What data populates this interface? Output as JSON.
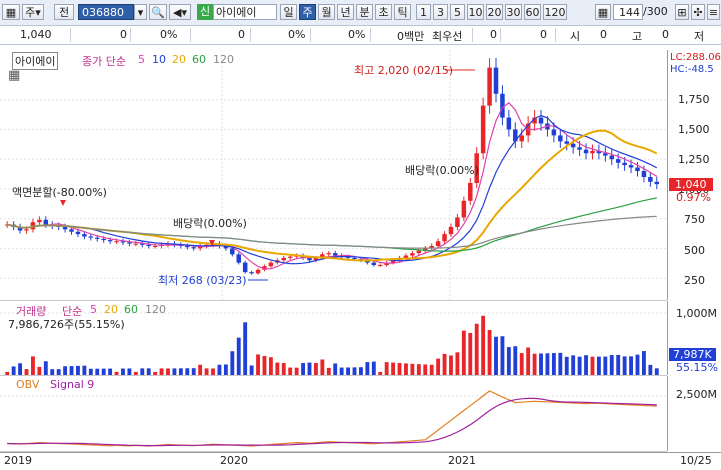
{
  "toolbar": {
    "market": "주",
    "prev": "전",
    "code": "036880",
    "mode": "신",
    "name": "아이에이",
    "periods": [
      "일",
      "주",
      "월",
      "년",
      "분",
      "초",
      "틱"
    ],
    "nums": [
      "1",
      "3",
      "5",
      "10",
      "20",
      "30",
      "60",
      "120"
    ],
    "count": "144",
    "total": "/300"
  },
  "info": {
    "price": "1,040",
    "v1": "0",
    "v2": "0%",
    "v3": "0",
    "v4": "0%",
    "v5": "0%",
    "v6": "0백만",
    "label1": "최우선",
    "v7": "0",
    "v8": "0",
    "l_si": "시",
    "v9": "0",
    "l_go": "고",
    "v10": "0",
    "l_jeo": "저"
  },
  "price_pane": {
    "title": "아이에이",
    "ma_label": "종가 단순",
    "ma": [
      "5",
      "10",
      "20",
      "60",
      "120"
    ],
    "lc": "LC:288.06",
    "hc": "HC:-48.5",
    "high_note": "최고 2,020 (02/15)",
    "low_note": "최저 268 (03/23)",
    "split_note": "액면분할(-80.00%)",
    "div_note1": "배당락(0.00%)",
    "div_note2": "배당락(0.00%)",
    "cur_price": "1,040",
    "cur_pct": "0.97%",
    "yticks": [
      "1,750",
      "1,500",
      "1,250",
      "1,000",
      "750",
      "500",
      "250"
    ]
  },
  "volume_pane": {
    "title": "거래량",
    "ma_label": "단순",
    "ma": [
      "5",
      "20",
      "60",
      "120"
    ],
    "value": "7,986,726주(55.15%)",
    "yticks": [
      "1,000M",
      "500M"
    ],
    "cur": "7,987K",
    "cur_pct": "55.15%"
  },
  "obv_pane": {
    "title": "OBV",
    "signal": "Signal 9",
    "yticks": [
      "2,500M"
    ]
  },
  "xaxis": [
    "2019",
    "2020",
    "2021",
    "10/25"
  ],
  "colors": {
    "up": "#e8262a",
    "down": "#1f3fd6",
    "ma5": "#e040b0",
    "ma10": "#1f3fd6",
    "ma20": "#e8a800",
    "ma60": "#2aa040",
    "ma120": "#888888"
  },
  "chart_data": {
    "type": "candlestick",
    "price_weekly_close_approx": [
      700,
      680,
      650,
      660,
      720,
      740,
      700,
      690,
      680,
      660,
      640,
      620,
      600,
      590,
      580,
      570,
      560,
      560,
      550,
      540,
      540,
      530,
      520,
      520,
      530,
      540,
      530,
      520,
      510,
      500,
      520,
      530,
      540,
      520,
      500,
      450,
      380,
      300,
      290,
      320,
      350,
      380,
      400,
      420,
      430,
      440,
      420,
      400,
      420,
      450,
      460,
      440,
      430,
      420,
      410,
      400,
      380,
      360,
      360,
      380,
      400,
      420,
      440,
      460,
      480,
      500,
      520,
      560,
      620,
      680,
      760,
      900,
      1050,
      1300,
      1700,
      2020,
      1800,
      1600,
      1500,
      1400,
      1450,
      1550,
      1600,
      1550,
      1500,
      1450,
      1400,
      1380,
      1350,
      1330,
      1300,
      1320,
      1300,
      1280,
      1250,
      1220,
      1200,
      1180,
      1150,
      1100,
      1060,
      1040
    ],
    "high": 2020,
    "low": 268,
    "last": 1040,
    "ylim": [
      150,
      2000
    ]
  }
}
